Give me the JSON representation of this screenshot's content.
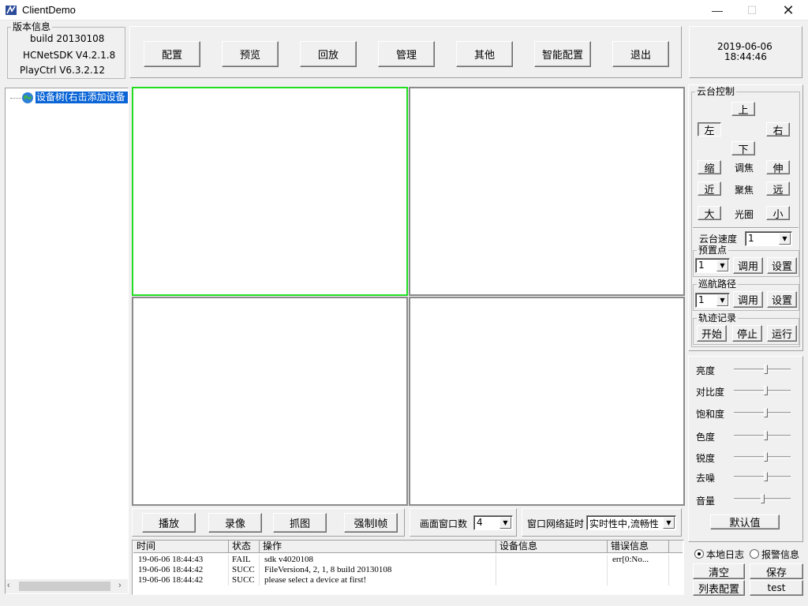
{
  "window": {
    "title": "ClientDemo"
  },
  "version_info": {
    "legend": "版本信息",
    "build": "build 20130108",
    "sdk": "HCNetSDK V4.2.1.8",
    "playctrl": "PlayCtrl V6.3.2.12"
  },
  "toolbar": {
    "config": "配置",
    "preview": "预览",
    "playback": "回放",
    "manage": "管理",
    "other": "其他",
    "smart_config": "智能配置",
    "exit": "退出"
  },
  "datetime": {
    "date": "2019-06-06",
    "time": "18:44:46"
  },
  "device_tree": {
    "root_label": "设备树(右击添加设备"
  },
  "ptz": {
    "legend": "云台控制",
    "up": "上",
    "left": "左",
    "right": "右",
    "down": "下",
    "zoom_out": "缩",
    "zoom_label": "调焦",
    "zoom_in": "伸",
    "focus_near": "近",
    "focus_label": "聚焦",
    "focus_far": "远",
    "iris_big": "大",
    "iris_label": "光圈",
    "iris_small": "小",
    "speed_label": "云台速度",
    "speed_value": "1",
    "preset_legend": "预置点",
    "preset_value": "1",
    "preset_call": "调用",
    "preset_set": "设置",
    "cruise_legend": "巡航路径",
    "cruise_value": "1",
    "cruise_call": "调用",
    "cruise_set": "设置",
    "track_legend": "轨迹记录",
    "track_start": "开始",
    "track_stop": "停止",
    "track_run": "运行"
  },
  "video_params": {
    "brightness": "亮度",
    "contrast": "对比度",
    "saturation": "饱和度",
    "hue": "色度",
    "sharpness": "锐度",
    "denoise": "去噪",
    "volume": "音量",
    "default_button": "默认值"
  },
  "playbar": {
    "play": "播放",
    "record": "录像",
    "capture": "抓图",
    "force_iframe": "强制I帧",
    "window_count_label": "画面窗口数",
    "window_count_value": "4",
    "net_delay_label": "窗口网络延时",
    "net_delay_value": "实时性中,流畅性"
  },
  "log": {
    "columns": [
      "时间",
      "状态",
      "操作",
      "设备信息",
      "错误信息"
    ],
    "rows": [
      {
        "time": "19-06-06 18:44:43",
        "status": "FAIL",
        "op": "sdk v4020108",
        "device": "",
        "error": "err[0:No..."
      },
      {
        "time": "19-06-06 18:44:42",
        "status": "SUCC",
        "op": "FileVersion4, 2, 1, 8 build 20130108",
        "device": "",
        "error": ""
      },
      {
        "time": "19-06-06 18:44:42",
        "status": "SUCC",
        "op": "please select a device at first!",
        "device": "",
        "error": ""
      }
    ]
  },
  "log_controls": {
    "local_log": "本地日志",
    "alarm_info": "报警信息",
    "clear": "清空",
    "save": "保存",
    "list_config": "列表配置",
    "test": "test"
  }
}
